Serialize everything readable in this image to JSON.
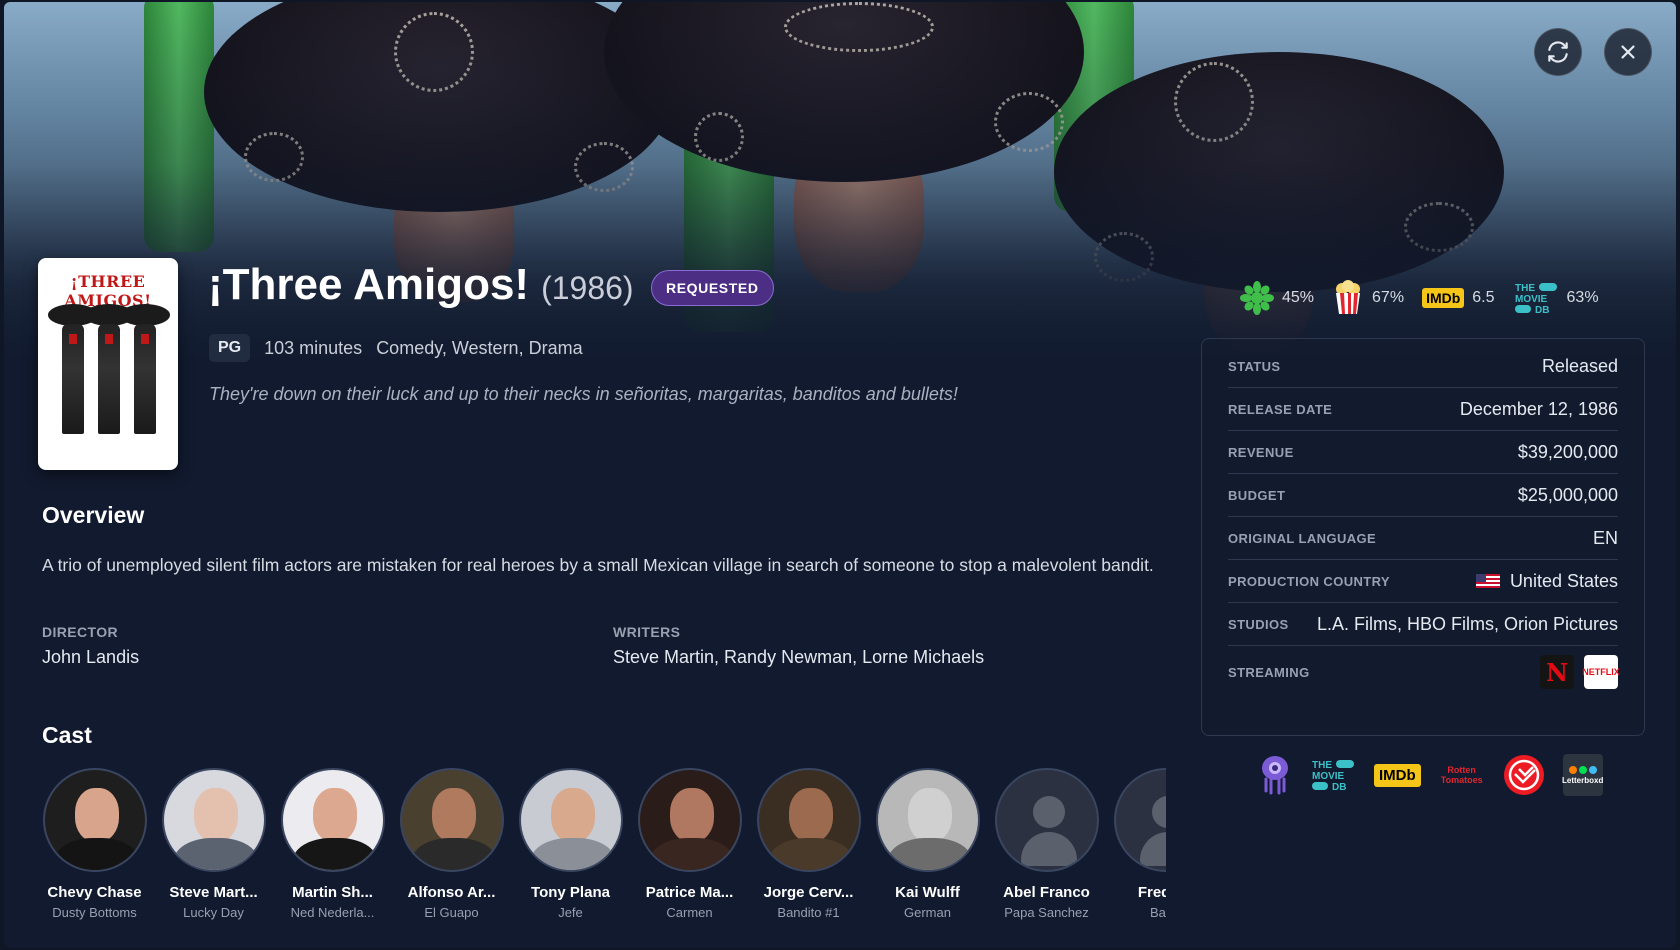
{
  "header": {
    "title": "¡Three Amigos!",
    "year": "(1986)",
    "status_badge": "REQUESTED",
    "content_rating": "PG",
    "runtime": "103 minutes",
    "genres": "Comedy, Western, Drama",
    "tagline": "They're down on their luck and up to their necks in señoritas, margaritas, banditos and bullets!",
    "poster_title": "¡THREE AMIGOS!"
  },
  "actions": {
    "refresh_icon": "refresh-icon",
    "close_icon": "close-icon"
  },
  "ratings": [
    {
      "source": "rotten-tomatoes-audience",
      "icon": "splat-icon",
      "value": "45%"
    },
    {
      "source": "rotten-tomatoes-critics",
      "icon": "popcorn-icon",
      "value": "67%"
    },
    {
      "source": "imdb",
      "logo_text": "IMDb",
      "value": "6.5"
    },
    {
      "source": "tmdb",
      "logo_text": "THE MOVIE DB",
      "value": "63%"
    }
  ],
  "overview": {
    "heading": "Overview",
    "text": "A trio of unemployed silent film actors are mistaken for real heroes by a small Mexican village in search of someone to stop a malevolent bandit.",
    "director_label": "DIRECTOR",
    "director": "John Landis",
    "writers_label": "WRITERS",
    "writers": "Steve Martin, Randy Newman, Lorne Michaels"
  },
  "info": {
    "status_label": "STATUS",
    "status": "Released",
    "release_label": "RELEASE DATE",
    "release": "December 12, 1986",
    "revenue_label": "REVENUE",
    "revenue": "$39,200,000",
    "budget_label": "BUDGET",
    "budget": "$25,000,000",
    "language_label": "ORIGINAL LANGUAGE",
    "language": "EN",
    "country_label": "PRODUCTION COUNTRY",
    "country": "United States",
    "studios_label": "STUDIOS",
    "studios": "L.A. Films, HBO Films, Orion Pictures",
    "streaming_label": "STREAMING",
    "streaming_n": "N",
    "streaming_text": "NETFLIX"
  },
  "external_links": [
    {
      "name": "jellyseerr",
      "icon": "jellyfish-icon"
    },
    {
      "name": "tmdb",
      "text": "THE MOVIE DB"
    },
    {
      "name": "imdb",
      "text": "IMDb"
    },
    {
      "name": "rotten-tomatoes",
      "text": "Rotten Tomatoes"
    },
    {
      "name": "trakt",
      "icon": "trakt-icon"
    },
    {
      "name": "letterboxd",
      "text": "Letterboxd"
    }
  ],
  "cast_heading": "Cast",
  "cast": [
    {
      "name": "Chevy Chase",
      "role": "Dusty Bottoms"
    },
    {
      "name": "Steve Mart...",
      "role": "Lucky Day"
    },
    {
      "name": "Martin Sh...",
      "role": "Ned Nederla..."
    },
    {
      "name": "Alfonso Ar...",
      "role": "El Guapo"
    },
    {
      "name": "Tony Plana",
      "role": "Jefe"
    },
    {
      "name": "Patrice Ma...",
      "role": "Carmen"
    },
    {
      "name": "Jorge Cerv...",
      "role": "Bandito #1"
    },
    {
      "name": "Kai Wulff",
      "role": "German"
    },
    {
      "name": "Abel Franco",
      "role": "Papa Sanchez"
    },
    {
      "name": "Fred As",
      "role": "Barte"
    }
  ],
  "colors": {
    "background": "#111a2e",
    "badge": "#4c2f85",
    "imdb": "#f5c518",
    "netflix": "#e50914"
  }
}
